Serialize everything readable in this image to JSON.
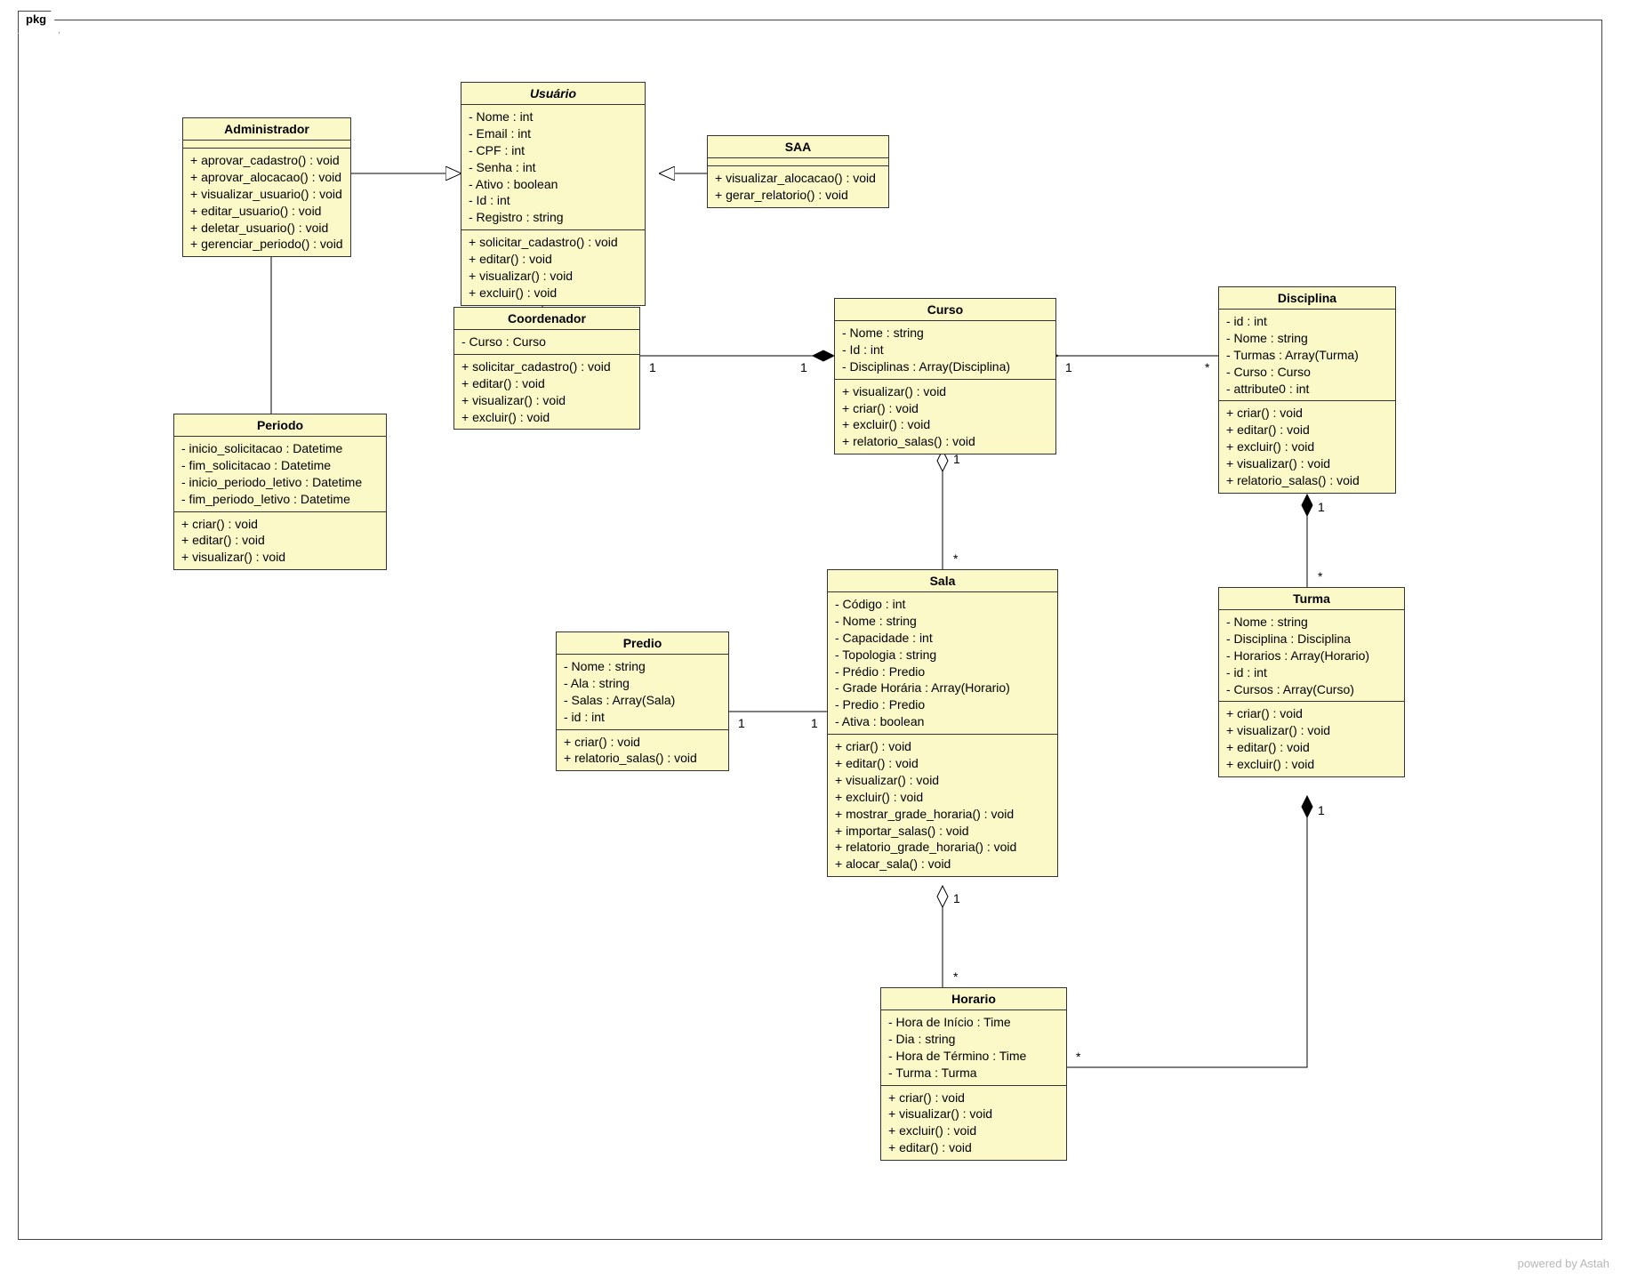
{
  "package_label": "pkg",
  "footer": "powered by Astah",
  "classes": {
    "administrador": {
      "title": "Administrador",
      "attrs": [],
      "ops": [
        "+ aprovar_cadastro() : void",
        "+ aprovar_alocacao() : void",
        "+ visualizar_usuario() : void",
        "+ editar_usuario() : void",
        "+ deletar_usuario() : void",
        "+ gerenciar_periodo() : void"
      ]
    },
    "usuario": {
      "title": "Usuário",
      "attrs": [
        "- Nome : int",
        "- Email : int",
        "- CPF : int",
        "- Senha : int",
        "- Ativo : boolean",
        "- Id : int",
        "- Registro : string"
      ],
      "ops": [
        "+ solicitar_cadastro() : void",
        "+ editar() : void",
        "+ visualizar() : void",
        "+ excluir() : void"
      ]
    },
    "saa": {
      "title": "SAA",
      "attrs": [],
      "ops": [
        "+ visualizar_alocacao() : void",
        "+ gerar_relatorio() : void"
      ]
    },
    "coordenador": {
      "title": "Coordenador",
      "attrs": [
        "- Curso : Curso"
      ],
      "ops": [
        "+ solicitar_cadastro() : void",
        "+ editar() : void",
        "+ visualizar() : void",
        "+ excluir() : void"
      ]
    },
    "periodo": {
      "title": "Periodo",
      "attrs": [
        "- inicio_solicitacao : Datetime",
        "- fim_solicitacao : Datetime",
        "- inicio_periodo_letivo : Datetime",
        "- fim_periodo_letivo : Datetime"
      ],
      "ops": [
        "+ criar() : void",
        "+ editar() : void",
        "+ visualizar() : void"
      ]
    },
    "curso": {
      "title": "Curso",
      "attrs": [
        "- Nome : string",
        "- Id : int",
        "- Disciplinas : Array(Disciplina)"
      ],
      "ops": [
        "+ visualizar() : void",
        "+ criar() : void",
        "+ excluir() : void",
        "+ relatorio_salas() : void"
      ]
    },
    "disciplina": {
      "title": "Disciplina",
      "attrs": [
        "- id : int",
        "- Nome : string",
        "- Turmas : Array(Turma)",
        "- Curso : Curso",
        "- attribute0 : int"
      ],
      "ops": [
        "+ criar() : void",
        "+ editar() : void",
        "+ excluir() : void",
        "+ visualizar() : void",
        "+ relatorio_salas() : void"
      ]
    },
    "sala": {
      "title": "Sala",
      "attrs": [
        "- Código : int",
        "- Nome : string",
        "- Capacidade : int",
        "- Topologia : string",
        "- Prédio : Predio",
        "- Grade Horária : Array(Horario)",
        "- Predio : Predio",
        "- Ativa : boolean"
      ],
      "ops": [
        "+ criar() : void",
        "+ editar() : void",
        "+ visualizar() : void",
        "+ excluir() : void",
        "+ mostrar_grade_horaria() : void",
        "+ importar_salas() : void",
        "+ relatorio_grade_horaria() : void",
        "+ alocar_sala() : void"
      ]
    },
    "predio": {
      "title": "Predio",
      "attrs": [
        "- Nome : string",
        "- Ala : string",
        "- Salas : Array(Sala)",
        "- id : int"
      ],
      "ops": [
        "+ criar() : void",
        "+ relatorio_salas() : void"
      ]
    },
    "turma": {
      "title": "Turma",
      "attrs": [
        "- Nome : string",
        "- Disciplina : Disciplina",
        "- Horarios : Array(Horario)",
        "- id : int",
        "- Cursos : Array(Curso)"
      ],
      "ops": [
        "+ criar() : void",
        "+ visualizar() : void",
        "+ editar() : void",
        "+ excluir() : void"
      ]
    },
    "horario": {
      "title": "Horario",
      "attrs": [
        "- Hora de Início : Time",
        "- Dia : string",
        "- Hora de Término : Time",
        "- Turma : Turma"
      ],
      "ops": [
        "+ criar() : void",
        "+ visualizar() : void",
        "+ excluir() : void",
        "+ editar() : void"
      ]
    }
  },
  "multiplicities": {
    "coord_curso_left": "1",
    "coord_curso_right": "1",
    "curso_disc_left": "1",
    "curso_disc_right": "*",
    "curso_sala_top": "1",
    "curso_sala_bottom": "*",
    "predio_sala_left": "1",
    "predio_sala_right": "1",
    "sala_horario_top": "1",
    "sala_horario_bottom": "*",
    "disc_turma_top": "1",
    "disc_turma_bottom": "*",
    "turma_horario_top": "1",
    "turma_horario_bottom": "*"
  },
  "chart_data": {
    "type": "uml_class_diagram",
    "package": "pkg",
    "classes": [
      {
        "name": "Administrador",
        "abstract": false,
        "attributes": [],
        "operations": [
          "aprovar_cadastro():void",
          "aprovar_alocacao():void",
          "visualizar_usuario():void",
          "editar_usuario():void",
          "deletar_usuario():void",
          "gerenciar_periodo():void"
        ]
      },
      {
        "name": "Usuário",
        "abstract": true,
        "attributes": [
          "Nome:int",
          "Email:int",
          "CPF:int",
          "Senha:int",
          "Ativo:boolean",
          "Id:int",
          "Registro:string"
        ],
        "operations": [
          "solicitar_cadastro():void",
          "editar():void",
          "visualizar():void",
          "excluir():void"
        ]
      },
      {
        "name": "SAA",
        "abstract": false,
        "attributes": [],
        "operations": [
          "visualizar_alocacao():void",
          "gerar_relatorio():void"
        ]
      },
      {
        "name": "Coordenador",
        "abstract": false,
        "attributes": [
          "Curso:Curso"
        ],
        "operations": [
          "solicitar_cadastro():void",
          "editar():void",
          "visualizar():void",
          "excluir():void"
        ]
      },
      {
        "name": "Periodo",
        "abstract": false,
        "attributes": [
          "inicio_solicitacao:Datetime",
          "fim_solicitacao:Datetime",
          "inicio_periodo_letivo:Datetime",
          "fim_periodo_letivo:Datetime"
        ],
        "operations": [
          "criar():void",
          "editar():void",
          "visualizar():void"
        ]
      },
      {
        "name": "Curso",
        "abstract": false,
        "attributes": [
          "Nome:string",
          "Id:int",
          "Disciplinas:Array(Disciplina)"
        ],
        "operations": [
          "visualizar():void",
          "criar():void",
          "excluir():void",
          "relatorio_salas():void"
        ]
      },
      {
        "name": "Disciplina",
        "abstract": false,
        "attributes": [
          "id:int",
          "Nome:string",
          "Turmas:Array(Turma)",
          "Curso:Curso",
          "attribute0:int"
        ],
        "operations": [
          "criar():void",
          "editar():void",
          "excluir():void",
          "visualizar():void",
          "relatorio_salas():void"
        ]
      },
      {
        "name": "Sala",
        "abstract": false,
        "attributes": [
          "Código:int",
          "Nome:string",
          "Capacidade:int",
          "Topologia:string",
          "Prédio:Predio",
          "Grade Horária:Array(Horario)",
          "Predio:Predio",
          "Ativa:boolean"
        ],
        "operations": [
          "criar():void",
          "editar():void",
          "visualizar():void",
          "excluir():void",
          "mostrar_grade_horaria():void",
          "importar_salas():void",
          "relatorio_grade_horaria():void",
          "alocar_sala():void"
        ]
      },
      {
        "name": "Predio",
        "abstract": false,
        "attributes": [
          "Nome:string",
          "Ala:string",
          "Salas:Array(Sala)",
          "id:int"
        ],
        "operations": [
          "criar():void",
          "relatorio_salas():void"
        ]
      },
      {
        "name": "Turma",
        "abstract": false,
        "attributes": [
          "Nome:string",
          "Disciplina:Disciplina",
          "Horarios:Array(Horario)",
          "id:int",
          "Cursos:Array(Curso)"
        ],
        "operations": [
          "criar():void",
          "visualizar():void",
          "editar():void",
          "excluir():void"
        ]
      },
      {
        "name": "Horario",
        "abstract": false,
        "attributes": [
          "Hora de Início:Time",
          "Dia:string",
          "Hora de Término:Time",
          "Turma:Turma"
        ],
        "operations": [
          "criar():void",
          "visualizar():void",
          "excluir():void",
          "editar():void"
        ]
      }
    ],
    "relationships": [
      {
        "type": "generalization",
        "child": "Administrador",
        "parent": "Usuário"
      },
      {
        "type": "generalization",
        "child": "SAA",
        "parent": "Usuário"
      },
      {
        "type": "generalization",
        "child": "Coordenador",
        "parent": "Usuário"
      },
      {
        "type": "association",
        "from": "Administrador",
        "to": "Periodo"
      },
      {
        "type": "composition",
        "whole": "Curso",
        "part": "Coordenador",
        "whole_mult": "1",
        "part_mult": "1"
      },
      {
        "type": "composition",
        "whole": "Curso",
        "part": "Disciplina",
        "whole_mult": "1",
        "part_mult": "*"
      },
      {
        "type": "aggregation",
        "whole": "Curso",
        "part": "Sala",
        "whole_mult": "1",
        "part_mult": "*"
      },
      {
        "type": "composition",
        "whole": "Predio",
        "part": "Sala",
        "whole_mult": "1",
        "part_mult": "1"
      },
      {
        "type": "aggregation",
        "whole": "Sala",
        "part": "Horario",
        "whole_mult": "1",
        "part_mult": "*"
      },
      {
        "type": "composition",
        "whole": "Disciplina",
        "part": "Turma",
        "whole_mult": "1",
        "part_mult": "*"
      },
      {
        "type": "composition",
        "whole": "Turma",
        "part": "Horario",
        "whole_mult": "1",
        "part_mult": "*"
      }
    ]
  }
}
